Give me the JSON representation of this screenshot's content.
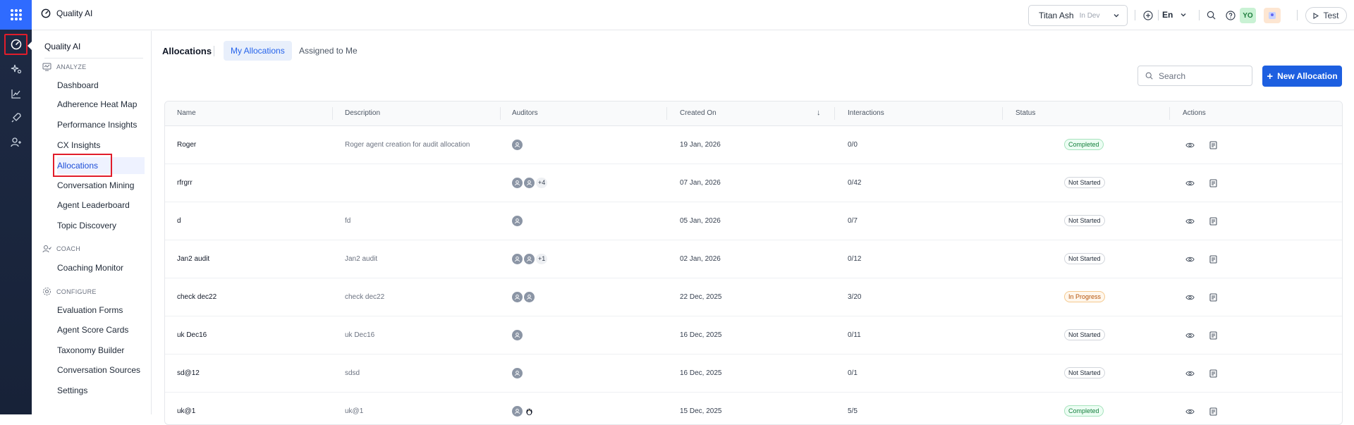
{
  "app": {
    "name": "Quality AI"
  },
  "colors": {
    "accent": "#1d5fe0",
    "rail": "#1e2a44",
    "highlight": "#e11d2b",
    "completed": "#15803d",
    "in_progress": "#b45309"
  },
  "topbar": {
    "tenant_name": "Titan Ash",
    "tenant_env": "In Dev",
    "language": "En",
    "avatar_initials": "YO",
    "test_label": "Test",
    "icons": [
      "add-circle-icon",
      "search-icon",
      "help-icon"
    ]
  },
  "sidebar": {
    "title": "Quality AI",
    "sections": [
      {
        "label": "ANALYZE",
        "icon": "analyze-icon"
      },
      {
        "label": "COACH",
        "icon": "coach-icon"
      },
      {
        "label": "CONFIGURE",
        "icon": "configure-icon"
      }
    ],
    "analyze_items": [
      "Dashboard",
      "Adherence Heat Map",
      "Performance Insights",
      "CX Insights",
      "Allocations",
      "Conversation Mining",
      "Agent Leaderboard",
      "Topic Discovery"
    ],
    "coach_items": [
      "Coaching Monitor"
    ],
    "configure_items": [
      "Evaluation Forms",
      "Agent Score Cards",
      "Taxonomy Builder",
      "Conversation Sources",
      "Settings"
    ],
    "active_item": "Allocations"
  },
  "main": {
    "title": "Allocations",
    "tabs": [
      "My Allocations",
      "Assigned to Me"
    ],
    "active_tab": "My Allocations",
    "search_placeholder": "Search",
    "new_button": "New Allocation",
    "columns": [
      "Name",
      "Description",
      "Auditors",
      "Created On",
      "Interactions",
      "Status",
      "Actions"
    ],
    "sort_indicator": "↓",
    "rows": [
      {
        "name": "Roger",
        "description": "Roger agent creation for audit allocation",
        "auditors": 1,
        "more": "",
        "created": "19 Jan, 2026",
        "interactions": "0/0",
        "status": "Completed"
      },
      {
        "name": "rfrgrr",
        "description": "",
        "auditors": 2,
        "more": "+4",
        "created": "07 Jan, 2026",
        "interactions": "0/42",
        "status": "Not Started"
      },
      {
        "name": "d",
        "description": "fd",
        "auditors": 1,
        "more": "",
        "created": "05 Jan, 2026",
        "interactions": "0/7",
        "status": "Not Started"
      },
      {
        "name": "Jan2 audit",
        "description": "Jan2 audit",
        "auditors": 2,
        "more": "+1",
        "created": "02 Jan, 2026",
        "interactions": "0/12",
        "status": "Not Started"
      },
      {
        "name": "check dec22",
        "description": "check dec22",
        "auditors": 2,
        "more": "",
        "created": "22 Dec, 2025",
        "interactions": "3/20",
        "status": "In Progress"
      },
      {
        "name": "uk Dec16",
        "description": "uk Dec16",
        "auditors": 1,
        "more": "",
        "created": "16 Dec, 2025",
        "interactions": "0/11",
        "status": "Not Started"
      },
      {
        "name": "sd@12",
        "description": "sdsd",
        "auditors": 1,
        "more": "",
        "created": "16 Dec, 2025",
        "interactions": "0/1",
        "status": "Not Started"
      },
      {
        "name": "uk@1",
        "description": "uk@1",
        "auditors": 2,
        "more": "",
        "created": "15 Dec, 2025",
        "interactions": "5/5",
        "status": "Completed"
      }
    ]
  }
}
